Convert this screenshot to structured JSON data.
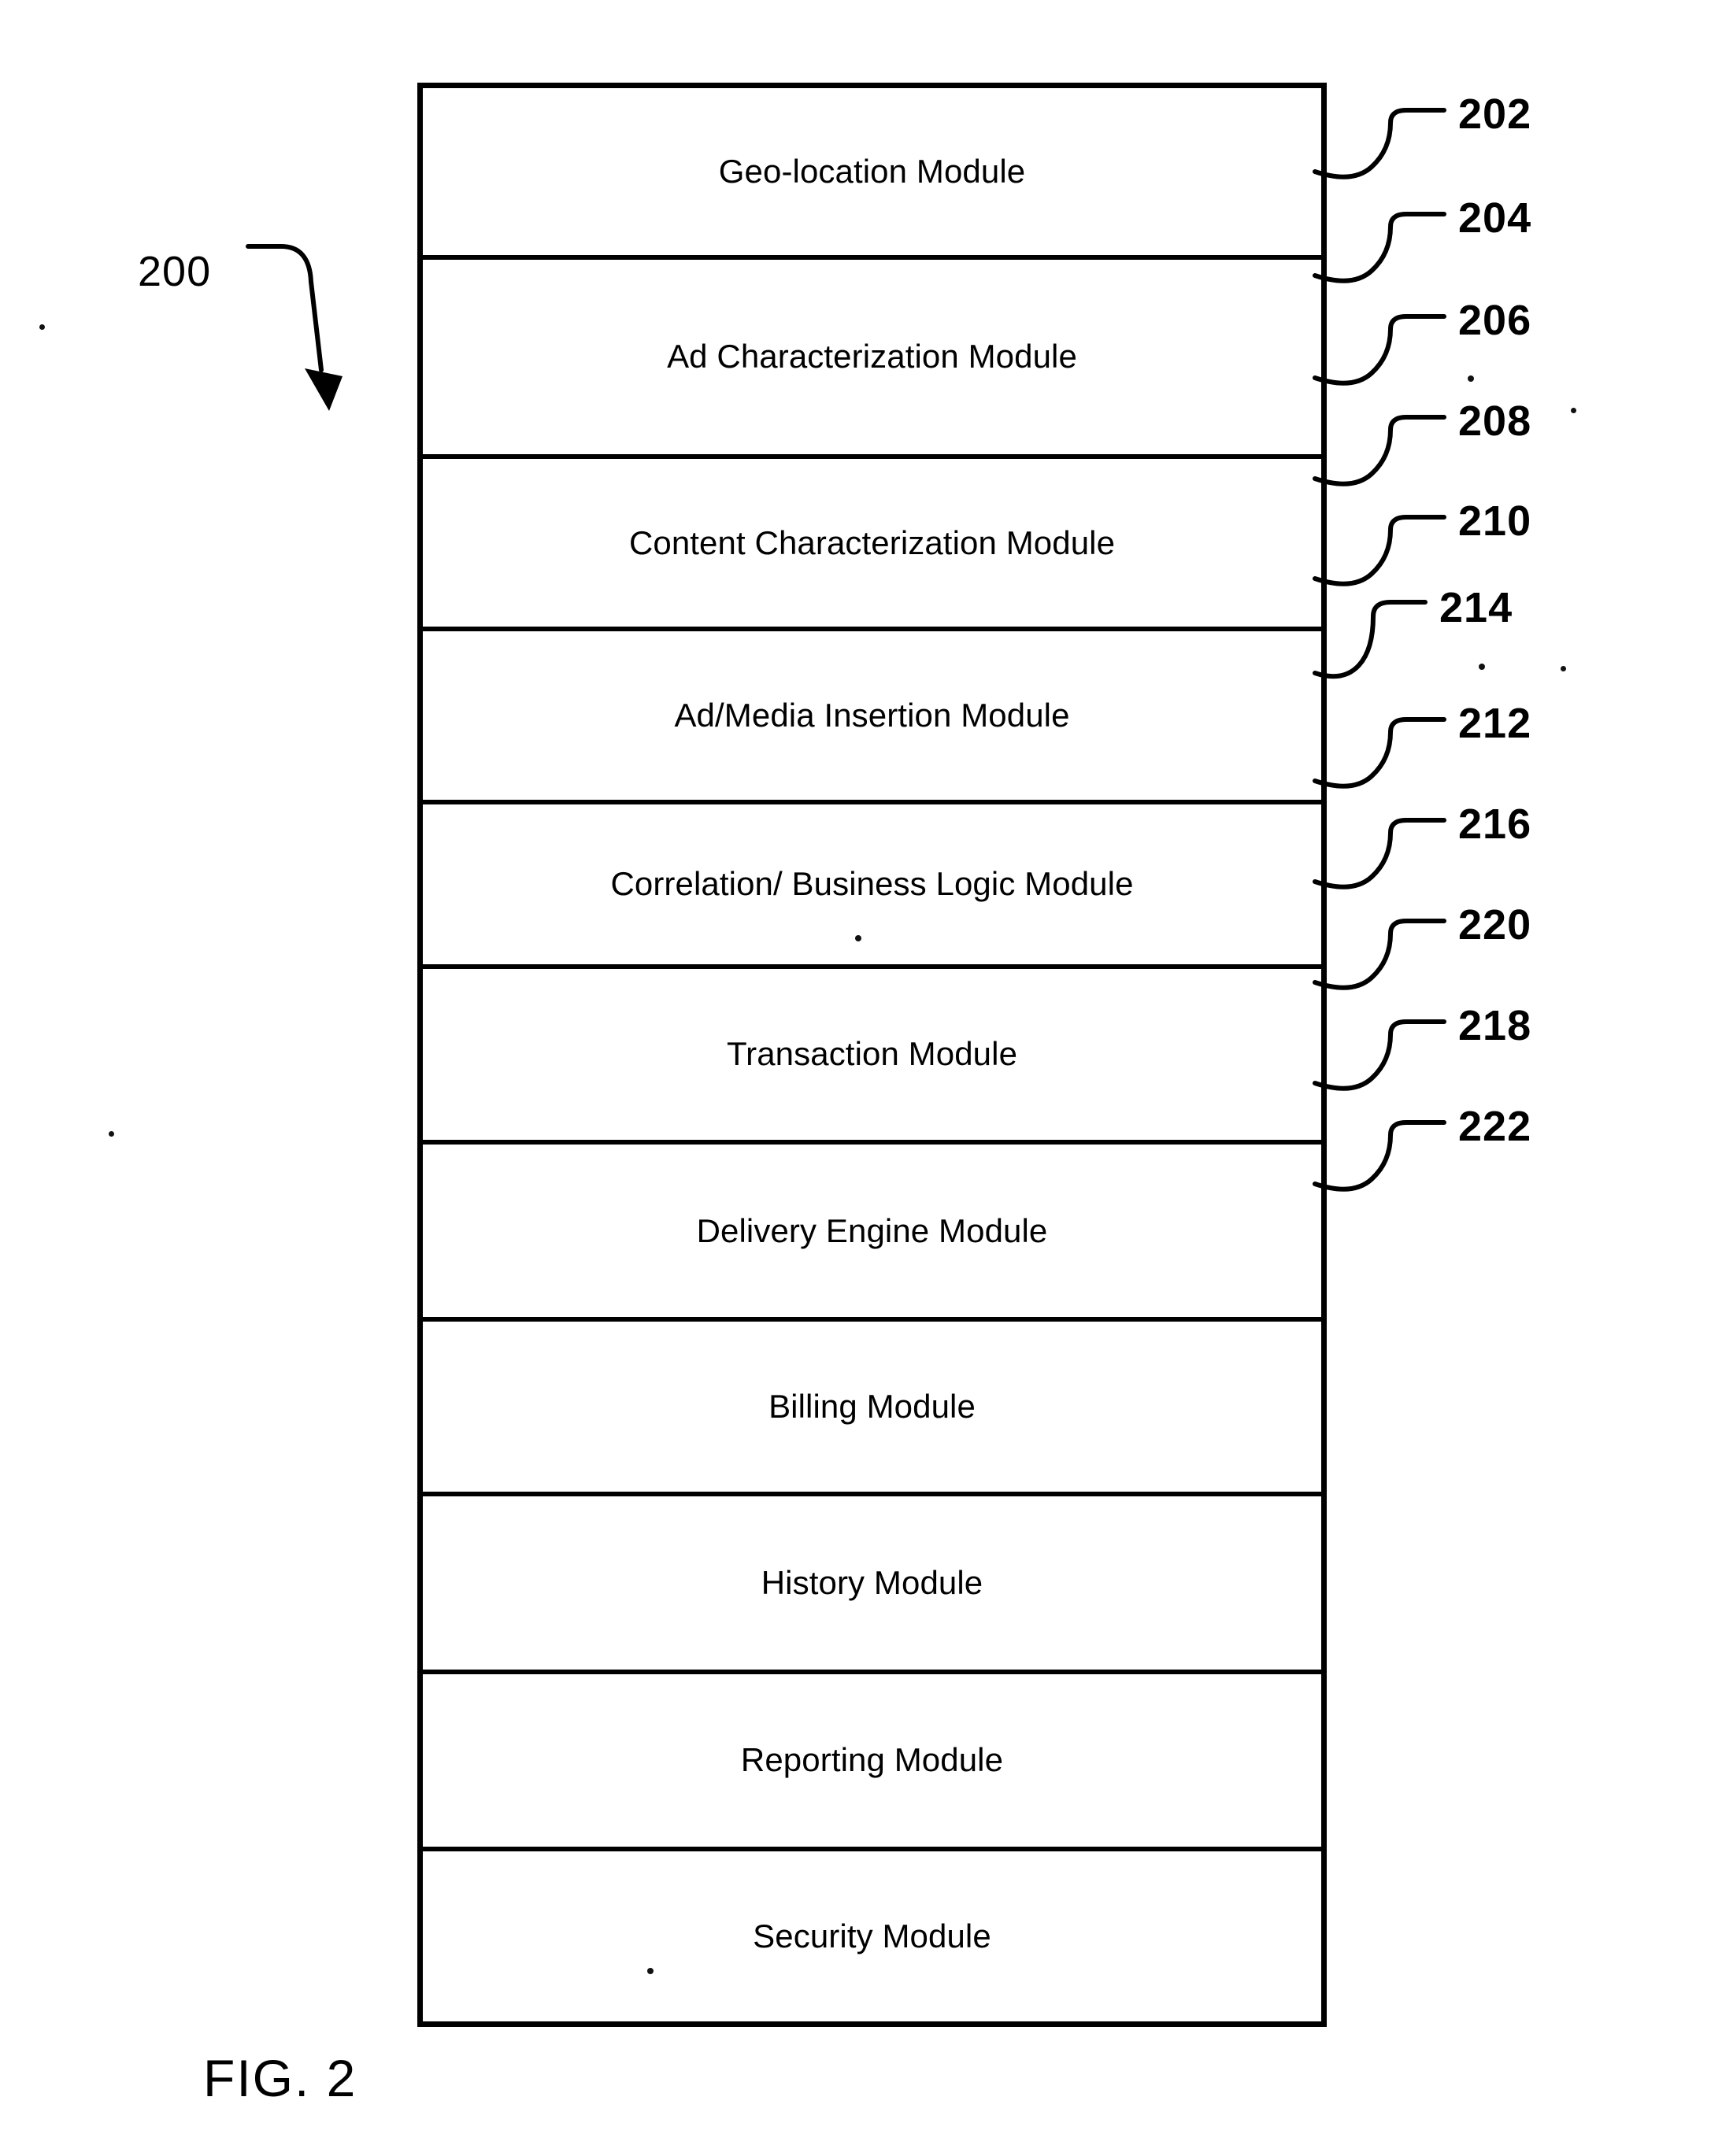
{
  "figure": {
    "caption": "FIG. 2",
    "system_ref": "200"
  },
  "modules": [
    {
      "label": "Geo-location Module",
      "ref": "202"
    },
    {
      "label": "Ad Characterization Module",
      "ref": "204"
    },
    {
      "label": "Content Characterization Module",
      "ref": "206"
    },
    {
      "label": "Ad/Media Insertion Module",
      "ref": "208"
    },
    {
      "label": "Correlation/ Business Logic Module",
      "ref": "210"
    },
    {
      "label": "Transaction Module",
      "ref": "214"
    },
    {
      "label": "Delivery Engine Module",
      "ref": "212"
    },
    {
      "label": "Billing Module",
      "ref": "216"
    },
    {
      "label": "History Module",
      "ref": "220"
    },
    {
      "label": "Reporting Module",
      "ref": "218"
    },
    {
      "label": "Security Module",
      "ref": "222"
    }
  ],
  "colors": {
    "ink": "#000000",
    "paper": "#ffffff"
  }
}
